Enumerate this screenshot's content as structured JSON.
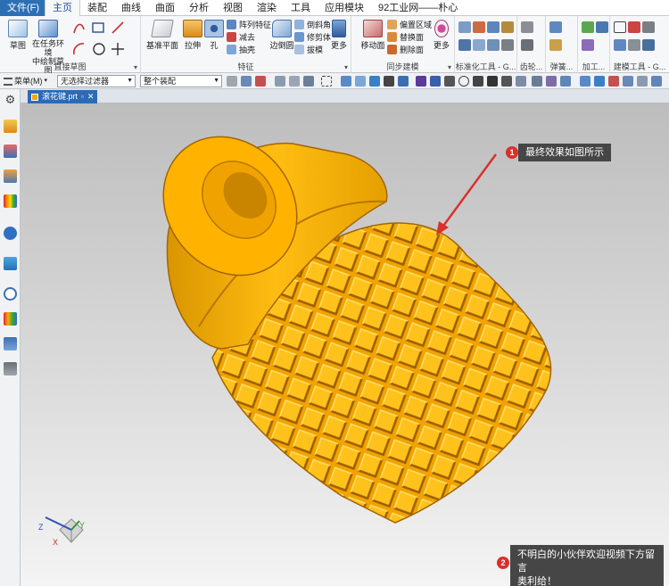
{
  "menu": {
    "tabs": [
      "文件(F)",
      "主页",
      "装配",
      "曲线",
      "曲面",
      "分析",
      "视图",
      "渲染",
      "工具",
      "应用模块",
      "92工业网——朴心"
    ],
    "active_index": 1
  },
  "ribbon": {
    "sketch": {
      "label": "草图"
    },
    "task_sketch": {
      "line1": "在任务环境",
      "line2": "中绘制草图"
    },
    "direct_sketch_group": "直接草图",
    "datum_plane": "基准平面",
    "extrude": "拉伸",
    "hole": "孔",
    "pattern_feature": "阵列特征",
    "subtract": "减去",
    "shell": "抽壳",
    "edge_blend": "边倒圆",
    "chamfer": "倒斜角",
    "trim_body": "修剪体",
    "draft": "拔模",
    "more": "更多",
    "feature_group": "特征",
    "move_face": "移动面",
    "offset_region": "偏置区域",
    "replace_face": "替换面",
    "delete_face": "删除面",
    "more2": "更多",
    "sync_group": "同步建模",
    "standard_tools": "标准化工具 - G...",
    "gear": "齿轮...",
    "spring": "弹簧...",
    "process": "加工...",
    "build_tools": "建模工具 - G..."
  },
  "selbar": {
    "menu": "菜单(M)",
    "filter": "无选择过滤器",
    "scope": "整个装配"
  },
  "document": {
    "tab_name": "滚花键.prt"
  },
  "callouts": [
    {
      "number": "1",
      "text": "最终效果如图所示"
    },
    {
      "number": "2",
      "text": "不明白的小伙伴欢迎视频下方留言\n奥利给！"
    }
  ],
  "axes": {
    "x": "X",
    "y": "Y",
    "z": "Z"
  },
  "colors": {
    "file_tab": "#2d6fb5",
    "part": "#f5a800",
    "part_dark": "#b87500",
    "callout_bg": "#464646",
    "badge": "#d9302c",
    "arrow": "#d9302c"
  }
}
